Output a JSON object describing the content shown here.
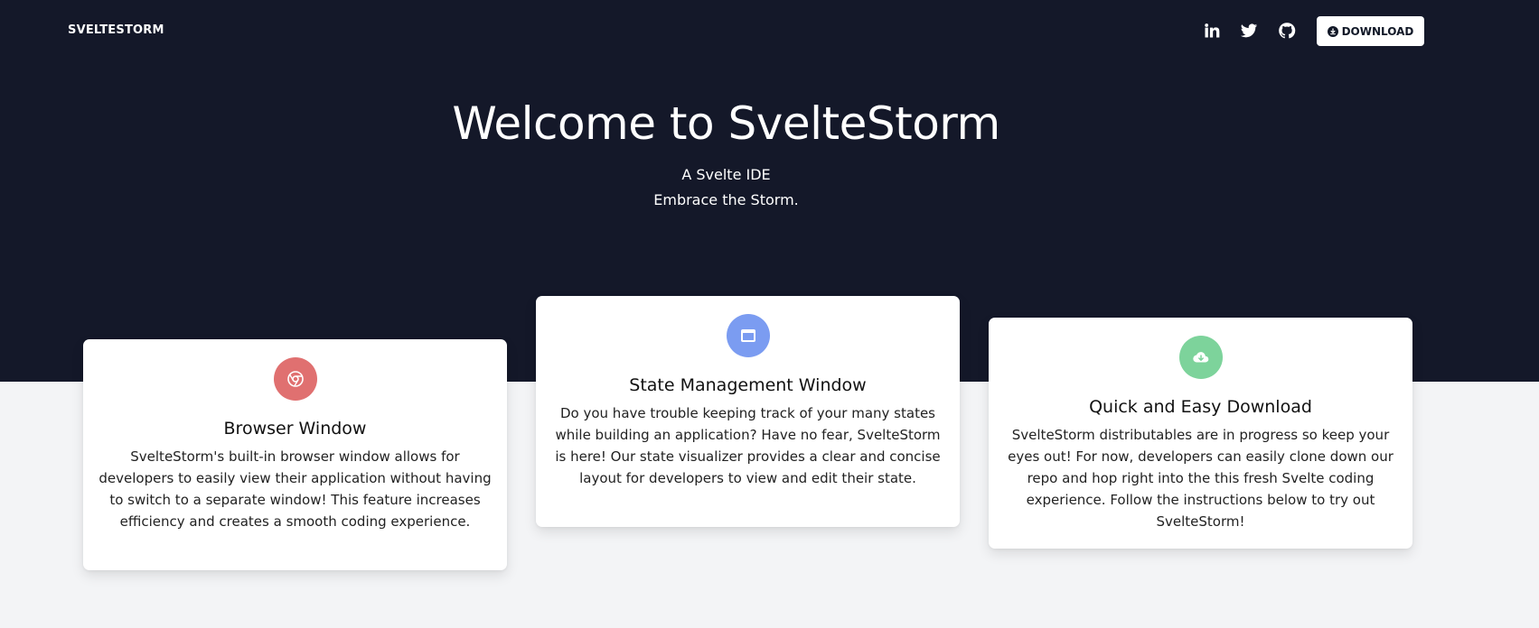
{
  "nav": {
    "brand": "SVELTESTORM",
    "social_icons": [
      "linkedin-icon",
      "twitter-icon",
      "github-icon"
    ],
    "download_label": "DOWNLOAD"
  },
  "hero": {
    "title": "Welcome to SvelteStorm",
    "subtitle_line1": "A Svelte IDE",
    "subtitle_line2": "Embrace the Storm.",
    "background_color": "#141829"
  },
  "cards": [
    {
      "title": "Browser Window",
      "icon": "chrome-icon",
      "color": "#e07070",
      "text": "SvelteStorm's built-in browser window allows for developers to easily view their application without having to switch to a separate window! This feature increases efficiency and creates a smooth coding experience."
    },
    {
      "title": "State Management Window",
      "icon": "window-icon",
      "color": "#7b9cf1",
      "text": "Do you have trouble keeping track of your many states while building an application? Have no fear, SvelteStorm is here! Our state visualizer provides a clear and concise layout for developers to view and edit their state."
    },
    {
      "title": "Quick and Easy Download",
      "icon": "cloud-download-icon",
      "color": "#7dd39b",
      "text": "SvelteStorm distributables are in progress so keep your eyes out! For now, developers can easily clone down our repo and hop right into the this fresh Svelte coding experience. Follow the instructions below to try out SvelteStorm!"
    }
  ]
}
